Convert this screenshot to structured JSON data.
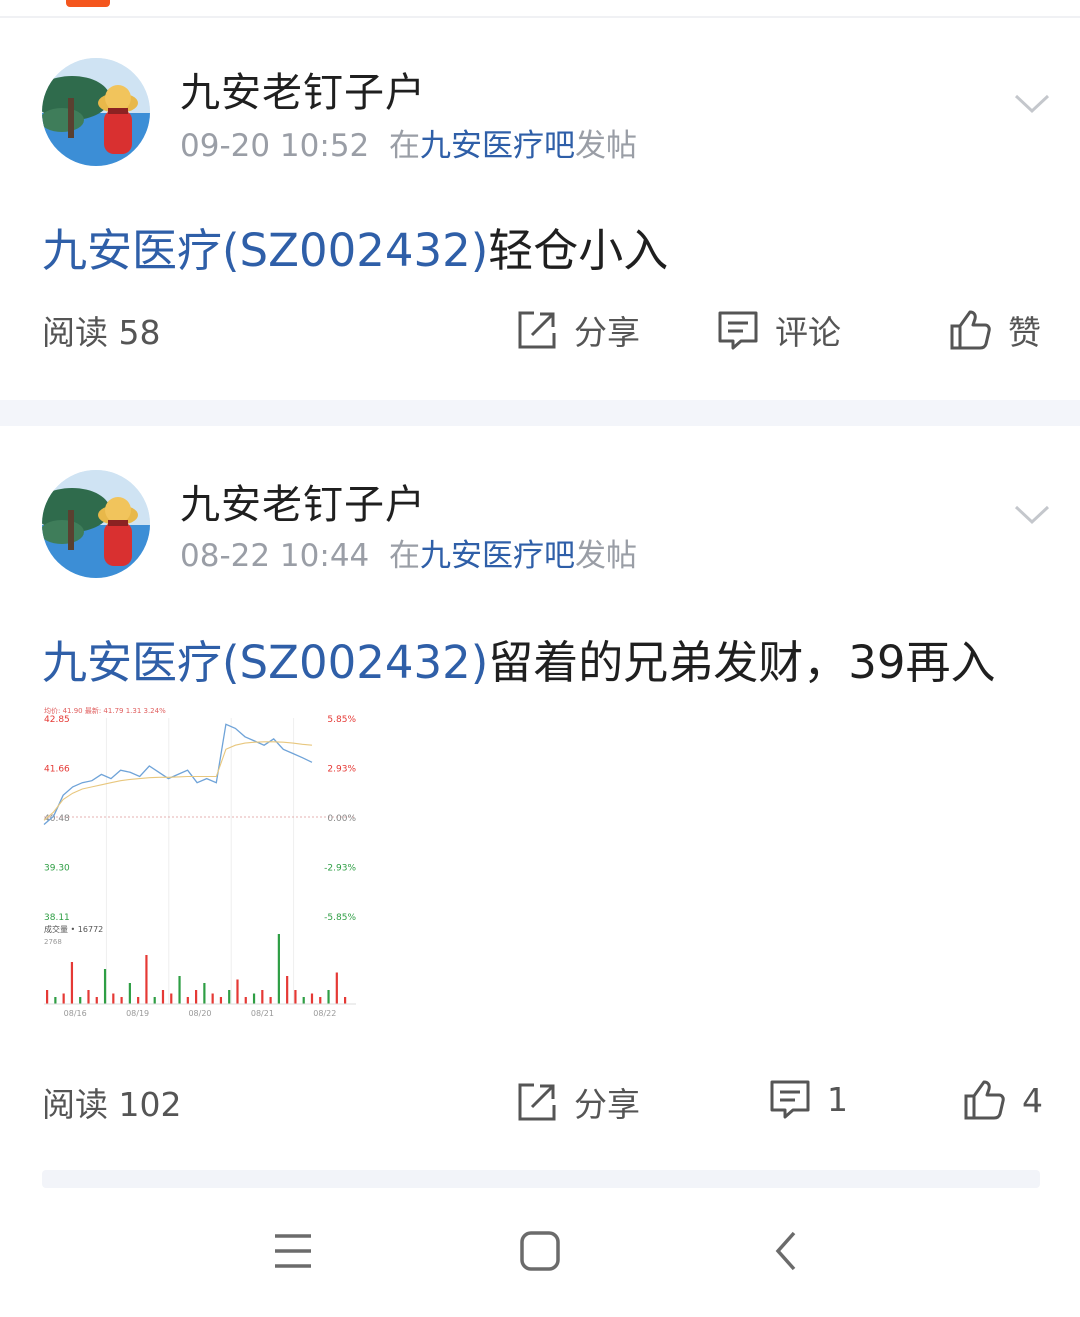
{
  "posts": [
    {
      "username": "九安老钉子户",
      "time": "09-20 10:52",
      "meta_prefix": "在",
      "forum": "九安医疗吧",
      "meta_suffix": "发帖",
      "title_stock": "九安医疗(SZ002432)",
      "title_text": "轻仓小入",
      "reads": "阅读 58",
      "share": "分享",
      "comment": "评论",
      "like": "赞"
    },
    {
      "username": "九安老钉子户",
      "time": "08-22 10:44",
      "meta_prefix": "在",
      "forum": "九安医疗吧",
      "meta_suffix": "发帖",
      "title_stock": "九安医疗(SZ002432)",
      "title_text": "留着的兄弟发财，39再入",
      "reads": "阅读 102",
      "share": "分享",
      "comment": "1",
      "like": "4"
    }
  ],
  "chart_data": {
    "type": "line",
    "title": "",
    "header_text": "均价: 41.90  最新: 41.79  1.31  3.24%",
    "y_left_ticks": [
      "42.85",
      "41.66",
      "40.48",
      "39.30",
      "38.11"
    ],
    "y_right_ticks": [
      "5.85%",
      "2.93%",
      "0.00%",
      "-2.93%",
      "-5.85%"
    ],
    "ylim": [
      38.11,
      42.85
    ],
    "x_ticks": [
      "08/16",
      "08/19",
      "08/20",
      "08/21",
      "08/22"
    ],
    "volume_label": "成交量 • 16772",
    "volume_max_label": "2768",
    "series": [
      {
        "name": "价格",
        "values": [
          40.3,
          40.5,
          41.0,
          41.2,
          41.3,
          41.35,
          41.5,
          41.4,
          41.6,
          41.55,
          41.45,
          41.7,
          41.55,
          41.4,
          41.5,
          41.6,
          41.3,
          41.4,
          41.3,
          42.7,
          42.6,
          42.4,
          42.3,
          42.2,
          42.35,
          42.1,
          42.0,
          41.9,
          41.79
        ]
      },
      {
        "name": "均价",
        "values": [
          40.4,
          40.6,
          40.9,
          41.05,
          41.15,
          41.2,
          41.25,
          41.3,
          41.35,
          41.38,
          41.4,
          41.42,
          41.43,
          41.43,
          41.44,
          41.45,
          41.45,
          41.45,
          41.45,
          42.1,
          42.2,
          42.25,
          42.27,
          42.28,
          42.28,
          42.27,
          42.25,
          42.22,
          42.2
        ]
      }
    ],
    "volume": [
      0.2,
      0.1,
      0.15,
      0.6,
      0.1,
      0.2,
      0.1,
      0.5,
      0.15,
      0.1,
      0.3,
      0.1,
      0.7,
      0.1,
      0.2,
      0.15,
      0.4,
      0.1,
      0.2,
      0.3,
      0.15,
      0.1,
      0.2,
      0.35,
      0.1,
      0.15,
      0.2,
      0.1,
      1.0,
      0.4,
      0.2,
      0.1,
      0.15,
      0.1,
      0.2,
      0.45,
      0.1
    ]
  },
  "navbar": {
    "items": [
      "menu-icon",
      "home-icon",
      "back-icon"
    ]
  },
  "colors": {
    "link": "#2f5fa8",
    "accent": "#f4561e",
    "up": "#e53935",
    "down": "#2e9e44",
    "price_line": "#6fa3d8",
    "avg_line": "#e8c77e"
  }
}
